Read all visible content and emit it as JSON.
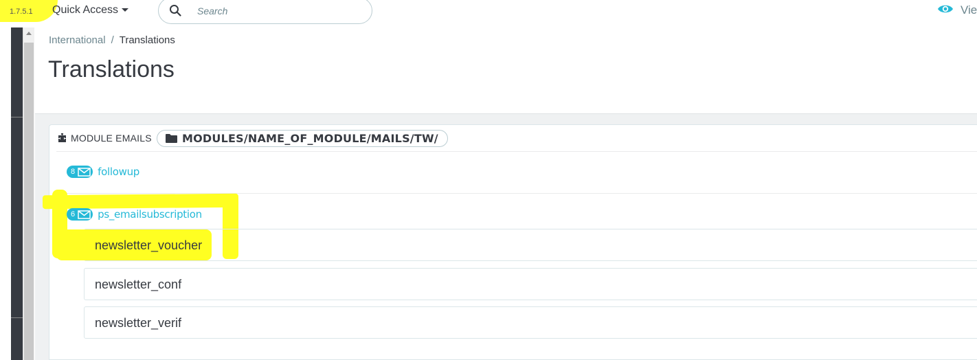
{
  "topbar": {
    "version": "1.7.5.1",
    "quick_access_label": "Quick Access",
    "search_placeholder": "Search",
    "view_label": "View"
  },
  "breadcrumb": {
    "parent": "International",
    "separator": "/",
    "current": "Translations"
  },
  "page_title": "Translations",
  "panel": {
    "label": "MODULE EMAILS",
    "path": "MODULES/NAME_OF_MODULE/MAILS/TW/",
    "modules": [
      {
        "count": "8",
        "name": "followup"
      },
      {
        "count": "6",
        "name": "ps_emailsubscription"
      }
    ],
    "emails": [
      "newsletter_voucher",
      "newsletter_conf",
      "newsletter_verif"
    ]
  },
  "colors": {
    "accent": "#25b9d7",
    "highlight": "#ffff22",
    "text": "#363a41",
    "background": "#eff1f2"
  }
}
